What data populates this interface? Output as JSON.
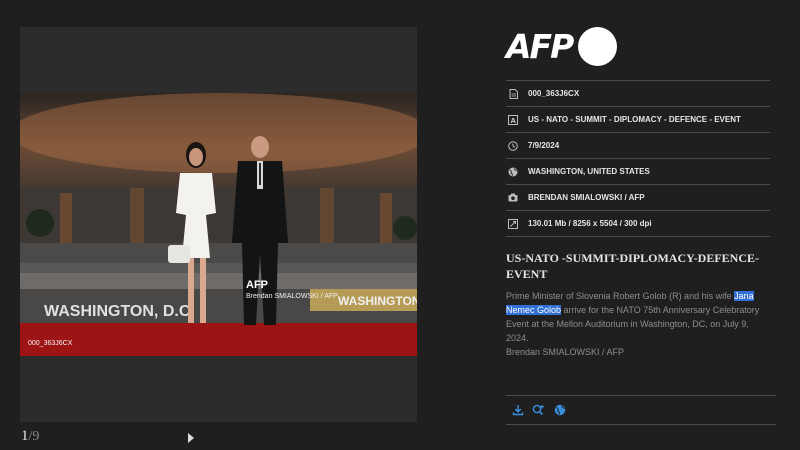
{
  "viewer": {
    "watermark_logo": "AFP",
    "watermark_credit": "Brendan SMIALOWSKI / AFP",
    "photo_id": "000_363J6CX",
    "sign_left": "WASHINGTON, D.C",
    "sign_right": "WASHINGTON",
    "pager": {
      "current": "1",
      "total": "/9"
    }
  },
  "brand": {
    "logo_text": "AFP"
  },
  "meta": {
    "rows": [
      {
        "icon": "document-icon",
        "text": "000_363J6CX"
      },
      {
        "icon": "tag-icon",
        "text": "US - NATO - SUMMIT - DIPLOMACY - DEFENCE - EVENT"
      },
      {
        "icon": "clock-icon",
        "text": "7/9/2024"
      },
      {
        "icon": "globe-icon",
        "text": "WASHINGTON, UNITED STATES"
      },
      {
        "icon": "camera-icon",
        "text": "BRENDAN SMIALOWSKI / AFP"
      },
      {
        "icon": "resize-icon",
        "text": "130.01 Mb / 8256 x 5504 / 300 dpi"
      }
    ]
  },
  "headline": "US-NATO -SUMMIT-DIPLOMACY-DEFENCE-EVENT",
  "caption": {
    "before": "Prime Minister of Slovenia Robert Golob (R) and his wife ",
    "highlight": "Jana Nemec Golob",
    "after": " arrive for the NATO 75th Anniversary Celebratory Event at the Mellon Auditorium in Washington, DC, on July 9, 2024.",
    "credit": "Brendan SMIALOWSKI / AFP"
  },
  "actions": [
    {
      "icon": "download-icon"
    },
    {
      "icon": "zoom-in-icon"
    },
    {
      "icon": "globe-icon"
    }
  ],
  "colors": {
    "accent": "#3a8fe0",
    "highlight": "#2f6fd6",
    "background": "#1f1f1f"
  }
}
